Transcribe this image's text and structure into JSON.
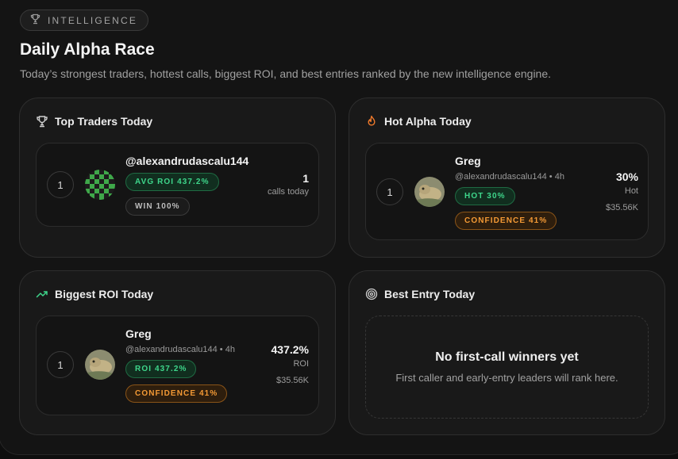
{
  "header": {
    "tag": "INTELLIGENCE",
    "title": "Daily Alpha Race",
    "subtitle": "Today’s strongest traders, hottest calls, biggest ROI, and best entries ranked by the new intelligence engine."
  },
  "top_traders": {
    "title": "Top Traders Today",
    "icon": "trophy-icon",
    "entry": {
      "rank": "1",
      "name": "@alexandrudascalu144",
      "badges": [
        "AVG ROI 437.2%",
        "WIN 100%"
      ],
      "stat_value": "1",
      "stat_label": "calls today"
    }
  },
  "hot_alpha": {
    "title": "Hot Alpha Today",
    "icon": "flame-icon",
    "entry": {
      "rank": "1",
      "name": "Greg",
      "handle": "@alexandrudascalu144 • 4h",
      "badges": [
        "HOT 30%",
        "CONFIDENCE 41%"
      ],
      "stat_value": "30%",
      "stat_label": "Hot",
      "stat_extra": "$35.56K"
    }
  },
  "biggest_roi": {
    "title": "Biggest ROI Today",
    "icon": "trending-up-icon",
    "entry": {
      "rank": "1",
      "name": "Greg",
      "handle": "@alexandrudascalu144 • 4h",
      "badges": [
        "ROI 437.2%",
        "CONFIDENCE 41%"
      ],
      "stat_value": "437.2%",
      "stat_label": "ROI",
      "stat_extra": "$35.56K"
    }
  },
  "best_entry": {
    "title": "Best Entry Today",
    "icon": "target-icon",
    "empty_title": "No first-call winners yet",
    "empty_desc": "First caller and early-entry leaders will rank here."
  },
  "colors": {
    "green": "#3ed68b",
    "orange": "#f49a35",
    "flame": "#f07a2b",
    "trend": "#3ed68b"
  }
}
